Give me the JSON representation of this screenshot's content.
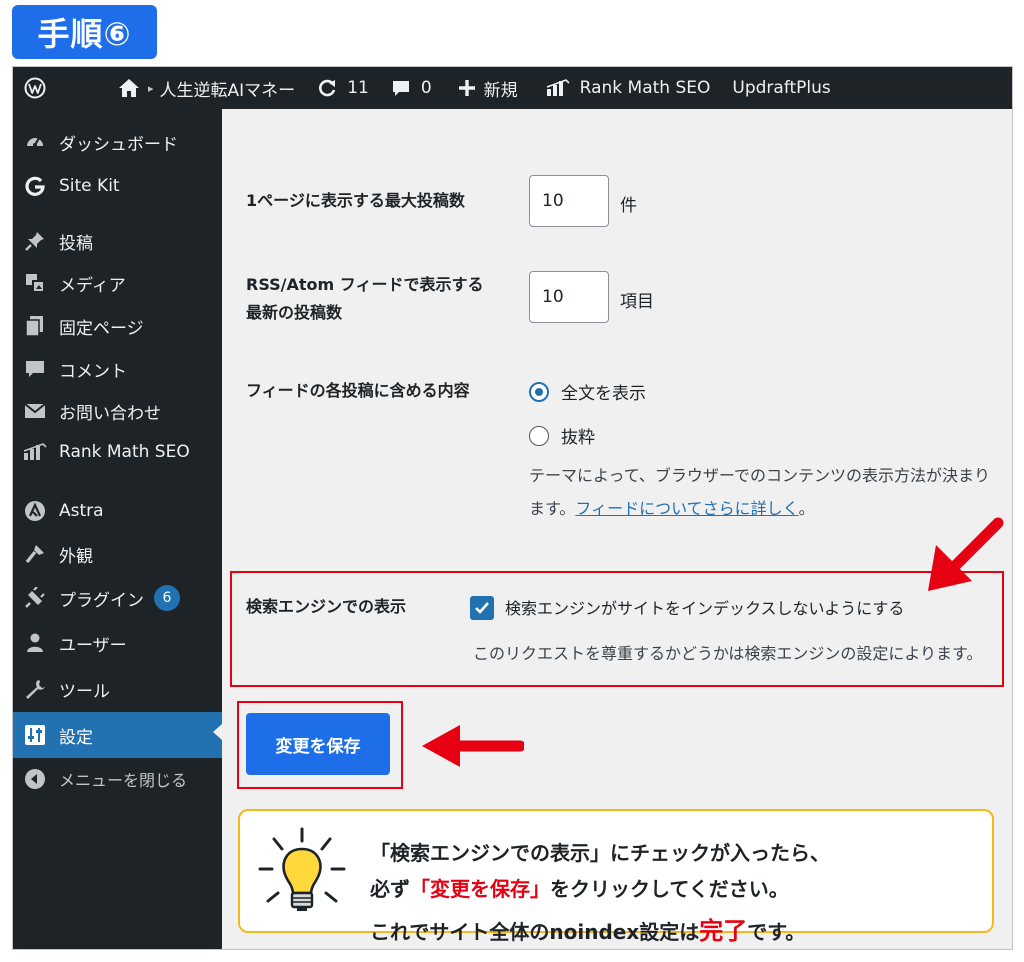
{
  "step_badge": "手順⑥",
  "adminbar": {
    "site_name": "人生逆転AIマネー",
    "updates_count": "11",
    "comments_count": "0",
    "new_label": "新規",
    "rankmath_label": "Rank Math SEO",
    "updraft_label": "UpdraftPlus"
  },
  "sidebar": {
    "items": [
      {
        "label": "ダッシュボード",
        "icon": "dashboard-icon"
      },
      {
        "label": "Site Kit",
        "icon": "sitekit-g-icon"
      },
      {
        "label": "投稿",
        "icon": "pin-icon"
      },
      {
        "label": "メディア",
        "icon": "media-icon"
      },
      {
        "label": "固定ページ",
        "icon": "pages-icon"
      },
      {
        "label": "コメント",
        "icon": "comment-icon"
      },
      {
        "label": "お問い合わせ",
        "icon": "mail-icon"
      },
      {
        "label": "Rank Math SEO",
        "icon": "rankmath-icon"
      },
      {
        "label": "Astra",
        "icon": "astra-icon"
      },
      {
        "label": "外観",
        "icon": "brush-icon"
      },
      {
        "label": "プラグイン",
        "icon": "plugin-icon",
        "badge": "6"
      },
      {
        "label": "ユーザー",
        "icon": "user-icon"
      },
      {
        "label": "ツール",
        "icon": "wrench-icon"
      },
      {
        "label": "設定",
        "icon": "settings-icon",
        "active": true
      }
    ],
    "collapse_label": "メニューを閉じる"
  },
  "form": {
    "posts_per_page_label": "1ページに表示する最大投稿数",
    "posts_per_page_value": "10",
    "posts_per_page_unit": "件",
    "rss_label_line1": "RSS/Atom フィードで表示する",
    "rss_label_line2": "最新の投稿数",
    "rss_value": "10",
    "rss_unit": "項目",
    "feed_content_label": "フィードの各投稿に含める内容",
    "feed_option_full": "全文を表示",
    "feed_option_excerpt": "抜粋",
    "feed_desc_line1": "テーマによって、ブラウザーでのコンテンツの表示方法が決まり",
    "feed_desc_line2_prefix": "ます。",
    "feed_desc_link": "フィードについてさらに詳しく",
    "feed_desc_suffix": "。",
    "search_label": "検索エンジンでの表示",
    "search_checkbox_label": "検索エンジンがサイトをインデックスしないようにする",
    "search_checked": true,
    "search_note": "このリクエストを尊重するかどうかは検索エンジンの設定によります。",
    "save_button": "変更を保存"
  },
  "tip": {
    "line1": "「検索エンジンでの表示」にチェックが入ったら、",
    "line2_a": "必ず",
    "line2_red": "「変更を保存」",
    "line2_b": "をクリックしてください。",
    "line3_a": "これでサイト全体のnoindex設定は",
    "line3_red": "完了",
    "line3_b": "です。"
  },
  "colors": {
    "accent_blue": "#2271b1",
    "highlight_red": "#e60012",
    "tip_border": "#f3b81c"
  }
}
